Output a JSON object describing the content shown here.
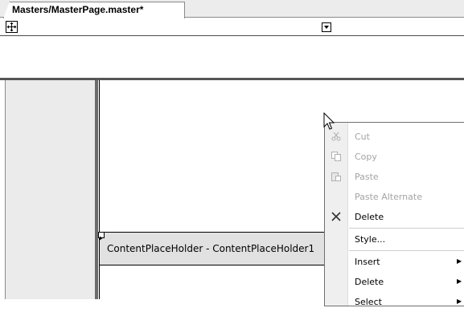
{
  "tab": {
    "title": "Masters/MasterPage.master*"
  },
  "placeholder": {
    "label": "ContentPlaceHolder - ContentPlaceHolder1"
  },
  "context_menu": {
    "items": [
      {
        "label": "Cut",
        "icon": "scissors-icon",
        "enabled": false
      },
      {
        "label": "Copy",
        "icon": "copy-icon",
        "enabled": false
      },
      {
        "label": "Paste",
        "icon": "paste-icon",
        "enabled": false
      },
      {
        "label": "Paste Alternate",
        "icon": "",
        "enabled": false
      },
      {
        "label": "Delete",
        "icon": "x-delete-icon",
        "enabled": true
      },
      {
        "label": "Style...",
        "icon": "",
        "enabled": true
      },
      {
        "label": "Insert",
        "icon": "",
        "enabled": true,
        "submenu": true
      },
      {
        "label": "Delete",
        "icon": "",
        "enabled": true,
        "submenu": true
      },
      {
        "label": "Select",
        "icon": "",
        "enabled": true,
        "submenu": true
      }
    ]
  }
}
